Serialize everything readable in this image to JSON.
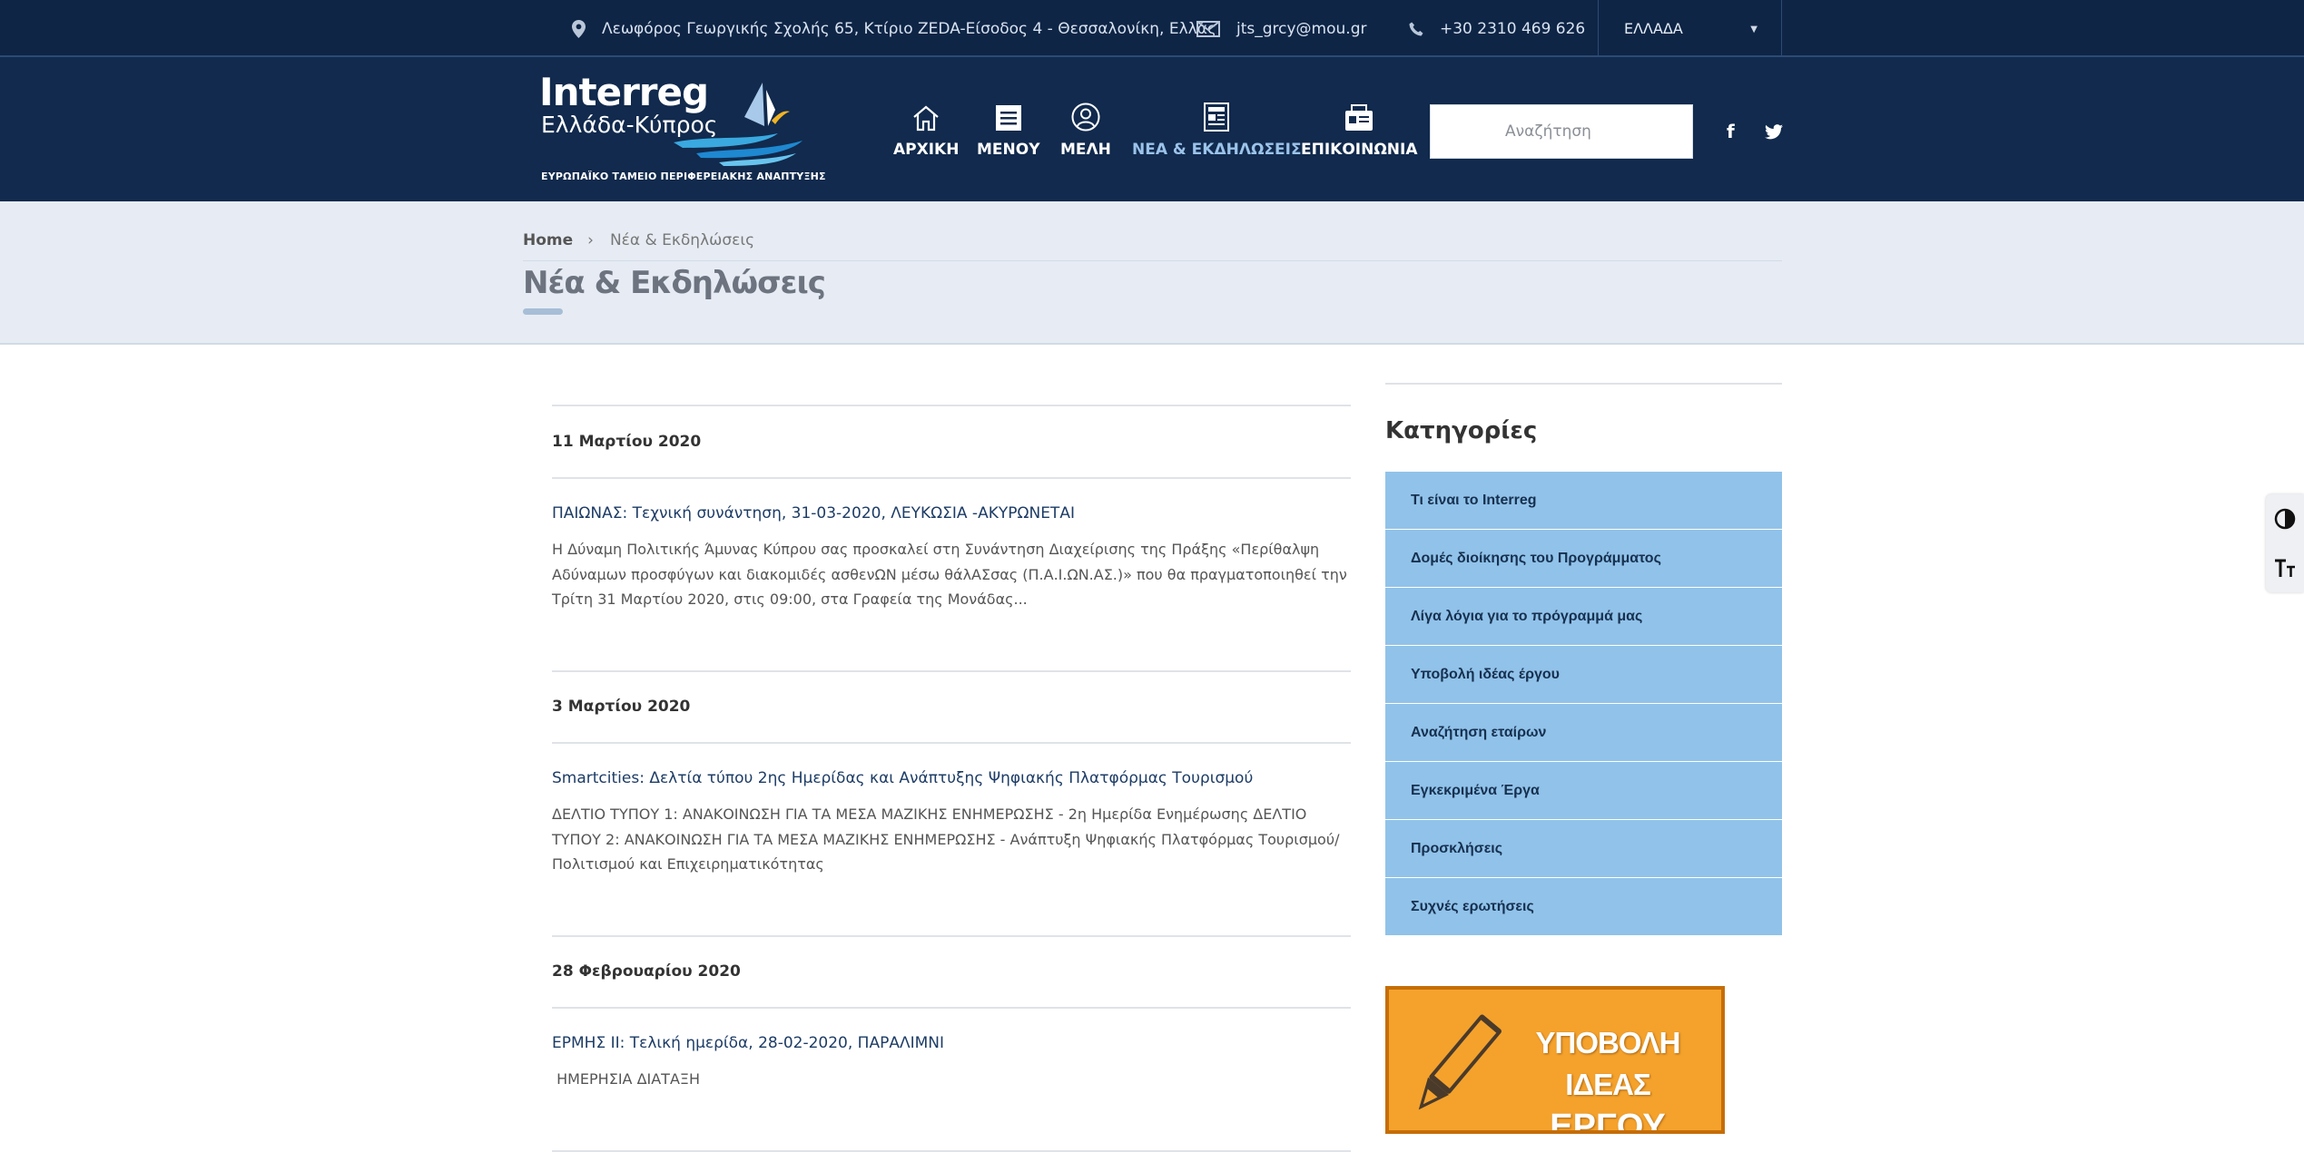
{
  "topbar": {
    "address": "Λεωφόρος Γεωργικής Σχολής 65, Κτίριο ZEDA-Είσοδος 4 - Θεσσαλονίκη, Ελλάς",
    "email": "jts_grcy@mou.gr",
    "phone": "+30 2310 469 626",
    "language": "ΕΛΛΑΔΑ"
  },
  "logo": {
    "line1": "Interreg",
    "line2": "Ελλάδα-Κύπρος",
    "line3": "ΕΥΡΩΠΑΪΚΟ ΤΑΜΕΙΟ ΠΕΡΙΦΕΡΕΙΑΚΗΣ ΑΝΑΠΤΥΞΗΣ"
  },
  "nav": {
    "items": [
      {
        "label": "ΑΡΧΙΚΗ",
        "icon": "home-icon"
      },
      {
        "label": "ΜΕΝΟΥ",
        "icon": "menu-icon"
      },
      {
        "label": "ΜΕΛΗ",
        "icon": "user-icon"
      },
      {
        "label": "ΝΕΑ & ΕΚΔΗΛΩΣΕΙΣ",
        "icon": "newspaper-icon",
        "active": true
      },
      {
        "label": "ΕΠΙΚΟΙΝΩΝΙΑ",
        "icon": "contact-icon"
      }
    ]
  },
  "search": {
    "placeholder": "Αναζήτηση"
  },
  "social": {
    "facebook": "f",
    "twitter": "twitter-icon"
  },
  "breadcrumb": {
    "home": "Home",
    "current": "Νέα & Εκδηλώσεις"
  },
  "page": {
    "title": "Νέα & Εκδηλώσεις"
  },
  "posts": [
    {
      "date": "11 Μαρτίου 2020",
      "title": "ΠΑΙΩΝΑΣ: Τεχνική συνάντηση, 31-03-2020, ΛΕΥΚΩΣΙΑ -ΑΚΥΡΩΝΕΤΑΙ",
      "excerpt": "Η Δύναμη Πολιτικής Άμυνας Κύπρου σας προσκαλεί στη Συνάντηση Διαχείρισης της Πράξης «Περίθαλψη Αδύναμων προσφύγων και διακομιδές ασθενΩΝ μέσω θάλΑΣσας (Π.Α.Ι.ΩΝ.ΑΣ.)» που θα πραγματοποιηθεί την Τρίτη 31 Μαρτίου 2020, στις 09:00, στα Γραφεία της Μονάδας..."
    },
    {
      "date": "3 Μαρτίου 2020",
      "title": "Smartcities: Δελτία τύπου 2ης Ημερίδας και Ανάπτυξης Ψηφιακής Πλατφόρμας Τουρισμού",
      "excerpt": "ΔΕΛΤΙΟ ΤΥΠΟΥ 1: ΑΝΑΚΟΙΝΩΣΗ ΓΙΑ ΤΑ ΜΕΣΑ ΜΑΖΙΚΗΣ ΕΝΗΜΕΡΩΣΗΣ - 2η Ημερίδα Ενημέρωσης  ΔΕΛΤΙΟ ΤΥΠΟΥ 2: ΑΝΑΚΟΙΝΩΣΗ ΓΙΑ ΤΑ ΜΕΣΑ ΜΑΖΙΚΗΣ ΕΝΗΜΕΡΩΣΗΣ - Ανάπτυξη Ψηφιακής Πλατφόρμας Τουρισμού/ Πολιτισμού και Επιχειρηματικότητας"
    },
    {
      "date": "28 Φεβρουαρίου 2020",
      "title": "ΕΡΜΗΣ ΙΙ: Τελική ημερίδα, 28-02-2020, ΠΑΡΑΛΙΜΝΙ",
      "excerpt": " ΗΜΕΡΗΣΙΑ ΔΙΑΤΑΞΗ"
    }
  ],
  "sidebar": {
    "heading": "Κατηγορίες",
    "categories": [
      "Τι είναι το Interreg",
      "Δομές διοίκησης του Προγράμματος",
      "Λίγα λόγια για το πρόγραμμά μας",
      "Υποβολή ιδέας έργου",
      "Αναζήτηση εταίρων",
      "Εγκεκριμένα Έργα",
      "Προσκλήσεις",
      "Συχνές ερωτήσεις"
    ],
    "banner": {
      "line1": "ΥΠΟΒΟΛΗ ΙΔΕΑΣ",
      "line2": "ΕΡΓΟΥ"
    }
  },
  "colors": {
    "topbar": "#0e2546",
    "header": "#112a4d",
    "nav_active": "#9cc3ea",
    "title_band": "#e7ecf4",
    "category_bg": "#91c2e9",
    "banner": "#f4a22c"
  }
}
